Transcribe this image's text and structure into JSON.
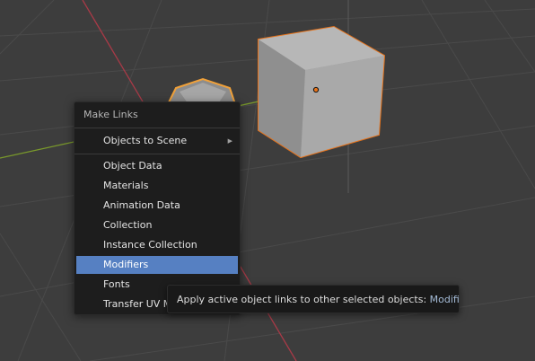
{
  "menu": {
    "title": "Make Links",
    "submenu_item": "Objects to Scene",
    "items": [
      "Object Data",
      "Materials",
      "Animation Data",
      "Collection",
      "Instance Collection",
      "Modifiers",
      "Fonts",
      "Transfer UV Maps"
    ],
    "active_item": "Modifiers"
  },
  "tooltip": {
    "description": "Apply active object links to other selected objects:",
    "value": "Modifiers"
  },
  "colors": {
    "background": "#3d3d3d",
    "menu_bg": "#1d1d1d",
    "highlight": "#5680c2",
    "selection_outline": "#e8731a",
    "x_axis": "#a83a47",
    "y_axis": "#7a9a2b"
  }
}
